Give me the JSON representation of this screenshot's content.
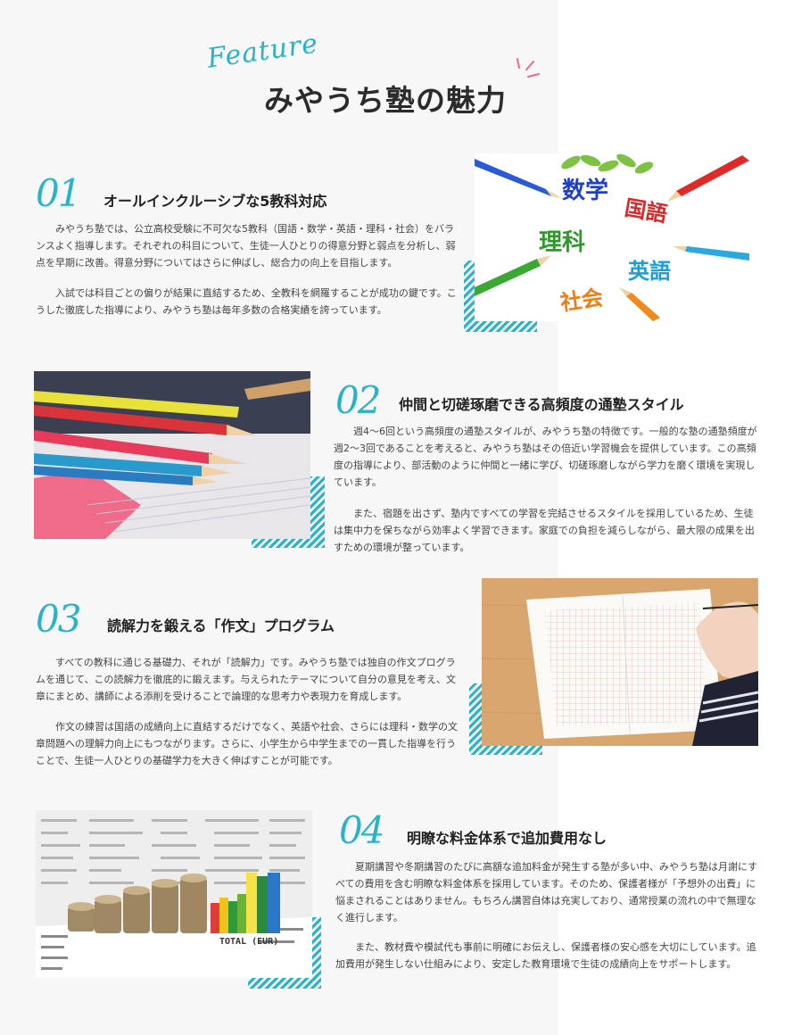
{
  "header": {
    "script_label": "Feature",
    "title": "みやうち塾の魅力"
  },
  "sections": [
    {
      "number": "01",
      "title": "オールインクルーシブな5教科対応",
      "paragraphs": [
        "みやうち塾では、公立高校受験に不可欠な5教科（国語・数学・英語・理科・社会）をバランスよく指導します。それぞれの科目について、生徒一人ひとりの得意分野と弱点を分析し、弱点を早期に改善。得意分野についてはさらに伸ばし、総合力の向上を目指します。",
        "入試では科目ごとの偏りが結果に直結するため、全教科を網羅することが成功の鍵です。こうした徹底した指導により、みやうち塾は毎年多数の合格実績を誇っています。"
      ],
      "image_words": [
        "数学",
        "国語",
        "理科",
        "英語",
        "社会"
      ]
    },
    {
      "number": "02",
      "title": "仲間と切磋琢磨できる高頻度の通塾スタイル",
      "paragraphs": [
        "週4～6回という高頻度の通塾スタイルが、みやうち塾の特徴です。一般的な塾の通塾頻度が週2～3回であることを考えると、みやうち塾はその倍近い学習機会を提供しています。この高頻度の指導により、部活動のように仲間と一緒に学び、切磋琢磨しながら学力を磨く環境を実現しています。",
        "また、宿題を出さず、塾内ですべての学習を完結させるスタイルを採用しているため、生徒は集中力を保ちながら効率よく学習できます。家庭での負担を減らしながら、最大限の成果を出すための環境が整っています。"
      ]
    },
    {
      "number": "03",
      "title": "読解力を鍛える「作文」プログラム",
      "paragraphs": [
        "すべての教科に通じる基礎力、それが「読解力」です。みやうち塾では独自の作文プログラムを通じて、この読解力を徹底的に鍛えます。与えられたテーマについて自分の意見を考え、文章にまとめ、講師による添削を受けることで論理的な思考力や表現力を育成します。",
        "作文の練習は国語の成績向上に直結するだけでなく、英語や社会、さらには理科・数学の文章問題への理解力向上にもつながります。さらに、小学生から中学生までの一貫した指導を行うことで、生徒一人ひとりの基礎学力を大きく伸ばすことが可能です。"
      ]
    },
    {
      "number": "04",
      "title": "明瞭な料金体系で追加費用なし",
      "paragraphs": [
        "夏期講習や冬期講習のたびに高額な追加料金が発生する塾が多い中、みやうち塾は月謝にすべての費用を含む明瞭な料金体系を採用しています。そのため、保護者様が「予想外の出費」に悩まされることはありません。もちろん講習自体は充実しており、通常授業の流れの中で無理なく進行します。",
        "また、教材費や模試代も事前に明確にお伝えし、保護者様の安心感を大切にしています。追加費用が発生しない仕組みにより、安定した教育環境で生徒の成績向上をサポートします。"
      ],
      "image_words": [
        "TOTAL (EUR)"
      ]
    }
  ],
  "colors": {
    "accent": "#29b3c7",
    "title": "#2b2b2b",
    "text": "#444444",
    "background": "#f7f7f7",
    "spark": "#e86a8a"
  }
}
